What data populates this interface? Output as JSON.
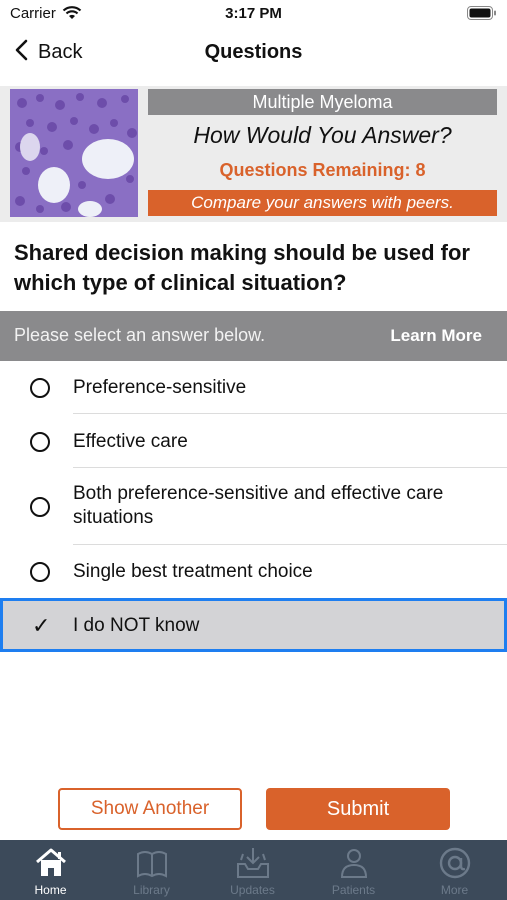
{
  "status": {
    "carrier": "Carrier",
    "time": "3:17 PM"
  },
  "nav": {
    "back_label": "Back",
    "title": "Questions"
  },
  "banner": {
    "topic": "Multiple Myeloma",
    "heading": "How Would You Answer?",
    "remaining": "Questions Remaining: 8",
    "compare": "Compare your answers with peers."
  },
  "question": "Shared decision making should be used for which type of clinical situation?",
  "select_bar": {
    "prompt": "Please select an answer below.",
    "learn_more": "Learn More"
  },
  "answers": [
    {
      "label": "Preference-sensitive",
      "selected": false
    },
    {
      "label": "Effective care",
      "selected": false
    },
    {
      "label": "Both preference-sensitive and effective care situations",
      "selected": false
    },
    {
      "label": "Single best treatment choice",
      "selected": false
    },
    {
      "label": "I do NOT know",
      "selected": true
    }
  ],
  "buttons": {
    "show_another": "Show Another",
    "submit": "Submit"
  },
  "tabs": [
    {
      "label": "Home",
      "icon": "home-icon",
      "active": true
    },
    {
      "label": "Library",
      "icon": "book-icon",
      "active": false
    },
    {
      "label": "Updates",
      "icon": "inbox-download-icon",
      "active": false
    },
    {
      "label": "Patients",
      "icon": "person-icon",
      "active": false
    },
    {
      "label": "More",
      "icon": "at-sign-icon",
      "active": false
    }
  ],
  "colors": {
    "accent": "#d9622b",
    "selection_border": "#1e7ef0",
    "tab_bar": "#3c4a5a",
    "gray_bar": "#8a8a8c"
  }
}
